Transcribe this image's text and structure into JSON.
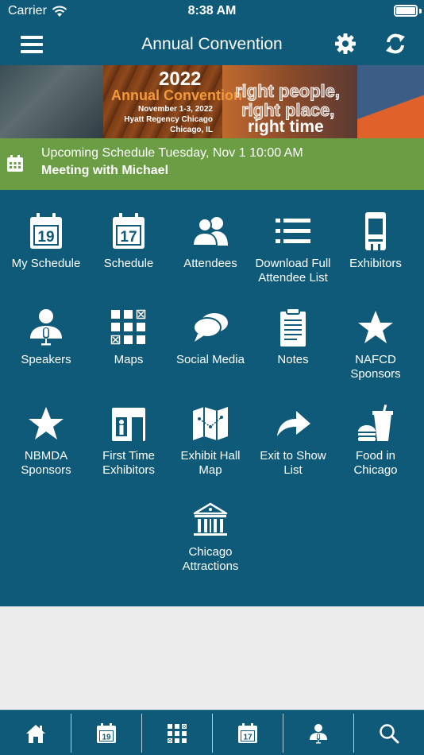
{
  "status": {
    "carrier": "Carrier",
    "time": "8:38 AM"
  },
  "nav": {
    "title": "Annual Convention"
  },
  "banner": {
    "year": "2022",
    "event": "Annual Convention",
    "dates": "November 1-3, 2022",
    "venue": "Hyatt Regency Chicago",
    "city": "Chicago, IL",
    "tagline1": "right people,",
    "tagline2": "right place,",
    "tagline3": "right time"
  },
  "upcoming": {
    "line1": "Upcoming Schedule Tuesday, Nov 1 10:00 AM",
    "line2": "Meeting with Michael"
  },
  "tiles": [
    {
      "label": "My Schedule",
      "icon": "calendar-19-icon"
    },
    {
      "label": "Schedule",
      "icon": "calendar-17-icon"
    },
    {
      "label": "Attendees",
      "icon": "people-icon"
    },
    {
      "label": "Download Full Attendee List",
      "icon": "list-icon"
    },
    {
      "label": "Exhibitors",
      "icon": "booth-icon"
    },
    {
      "label": "Speakers",
      "icon": "speaker-icon"
    },
    {
      "label": "Maps",
      "icon": "map-grid-icon"
    },
    {
      "label": "Social Media",
      "icon": "chat-bubbles-icon"
    },
    {
      "label": "Notes",
      "icon": "notepad-icon"
    },
    {
      "label": "NAFCD Sponsors",
      "icon": "star-icon"
    },
    {
      "label": "NBMDA Sponsors",
      "icon": "star-icon"
    },
    {
      "label": "First Time Exhibitors",
      "icon": "first-time-booth-icon"
    },
    {
      "label": "Exhibit Hall Map",
      "icon": "folded-map-icon"
    },
    {
      "label": "Exit to Show List",
      "icon": "share-arrow-icon"
    },
    {
      "label": "Food in Chicago",
      "icon": "fast-food-icon"
    },
    {
      "label": "Chicago Attractions",
      "icon": "landmark-icon"
    }
  ],
  "tabs": [
    {
      "icon": "home-icon"
    },
    {
      "icon": "calendar-19-icon"
    },
    {
      "icon": "map-grid-icon"
    },
    {
      "icon": "calendar-17-icon"
    },
    {
      "icon": "speaker-icon"
    },
    {
      "icon": "search-icon"
    }
  ],
  "calendar_numbers": {
    "my_schedule": "19",
    "schedule": "17"
  },
  "colors": {
    "primary": "#0f5a78",
    "accent": "#6a9d44",
    "background": "#ececec"
  }
}
